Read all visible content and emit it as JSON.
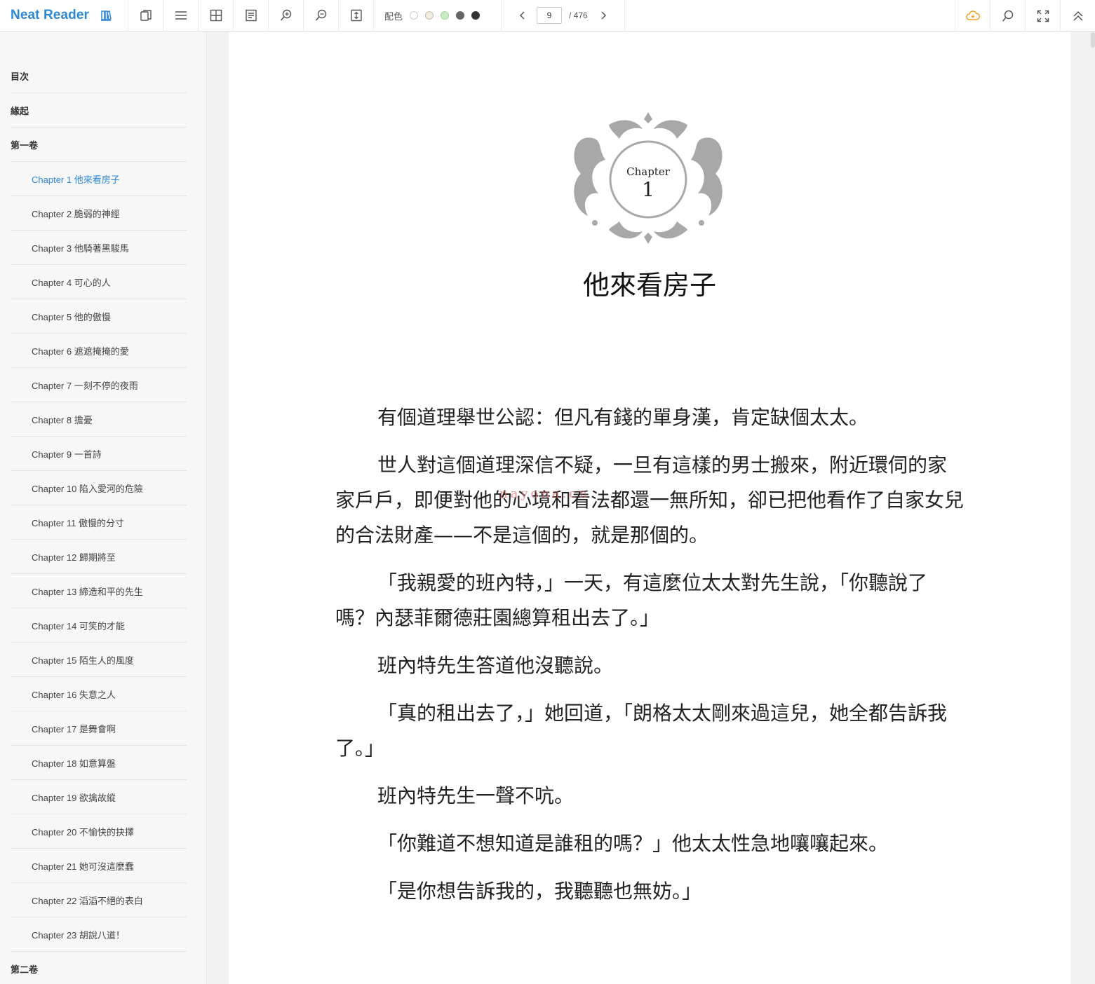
{
  "app": {
    "brand": "Neat Reader",
    "color_label": "配色",
    "swatches": [
      "#ffffff",
      "#f3ece0",
      "#c8ecc6",
      "#666666",
      "#333333"
    ],
    "page_current": "9",
    "page_total": "/ 476",
    "accent": "#2d87d7"
  },
  "toc": {
    "items": [
      {
        "label": "目次",
        "type": "section"
      },
      {
        "label": "緣起",
        "type": "section"
      },
      {
        "label": "第一卷",
        "type": "section"
      },
      {
        "label": "Chapter 1 他來看房子",
        "type": "chapter",
        "active": true
      },
      {
        "label": "Chapter 2 脆弱的神經",
        "type": "chapter"
      },
      {
        "label": "Chapter 3 他騎著黑駿馬",
        "type": "chapter"
      },
      {
        "label": "Chapter 4 可心的人",
        "type": "chapter"
      },
      {
        "label": "Chapter 5 他的傲慢",
        "type": "chapter"
      },
      {
        "label": "Chapter 6 遮遮掩掩的愛",
        "type": "chapter"
      },
      {
        "label": "Chapter 7 一刻不停的夜雨",
        "type": "chapter"
      },
      {
        "label": "Chapter 8 擔憂",
        "type": "chapter"
      },
      {
        "label": "Chapter 9 一首詩",
        "type": "chapter"
      },
      {
        "label": "Chapter 10 陷入愛河的危險",
        "type": "chapter"
      },
      {
        "label": "Chapter 11 傲慢的分寸",
        "type": "chapter"
      },
      {
        "label": "Chapter 12 歸期將至",
        "type": "chapter"
      },
      {
        "label": "Chapter 13 締造和平的先生",
        "type": "chapter"
      },
      {
        "label": "Chapter 14 可笑的才能",
        "type": "chapter"
      },
      {
        "label": "Chapter 15 陌生人的風度",
        "type": "chapter"
      },
      {
        "label": "Chapter 16 失意之人",
        "type": "chapter"
      },
      {
        "label": "Chapter 17 是舞會啊",
        "type": "chapter"
      },
      {
        "label": "Chapter 18 如意算盤",
        "type": "chapter"
      },
      {
        "label": "Chapter 19 欲擒故縱",
        "type": "chapter"
      },
      {
        "label": "Chapter 20 不愉快的抉擇",
        "type": "chapter"
      },
      {
        "label": "Chapter 21 她可沒這麼蠢",
        "type": "chapter"
      },
      {
        "label": "Chapter 22 滔滔不絕的表白",
        "type": "chapter"
      },
      {
        "label": "Chapter 23 胡說八道！",
        "type": "chapter"
      },
      {
        "label": "第二卷",
        "type": "section"
      }
    ]
  },
  "page": {
    "ornament_label": "Chapter",
    "ornament_number": "1",
    "title": "他來看房子",
    "watermark": "nayona.cn",
    "paragraphs": [
      "有個道理舉世公認：但凡有錢的單身漢，肯定缺個太太。",
      "世人對這個道理深信不疑，一旦有這樣的男士搬來，附近環伺的家家戶戶，即便對他的心境和看法都還一無所知，卻已把他看作了自家女兒的合法財產——不是這個的，就是那個的。",
      "「我親愛的班內特，」一天，有這麼位太太對先生說，「你聽說了嗎？內瑟菲爾德莊園總算租出去了。」",
      "班內特先生答道他沒聽說。",
      "「真的租出去了，」她回道，「朗格太太剛來過這兒，她全都告訴我了。」",
      "班內特先生一聲不吭。",
      "「你難道不想知道是誰租的嗎？」他太太性急地嚷嚷起來。",
      "「是你想告訴我的，我聽聽也無妨。」"
    ]
  }
}
